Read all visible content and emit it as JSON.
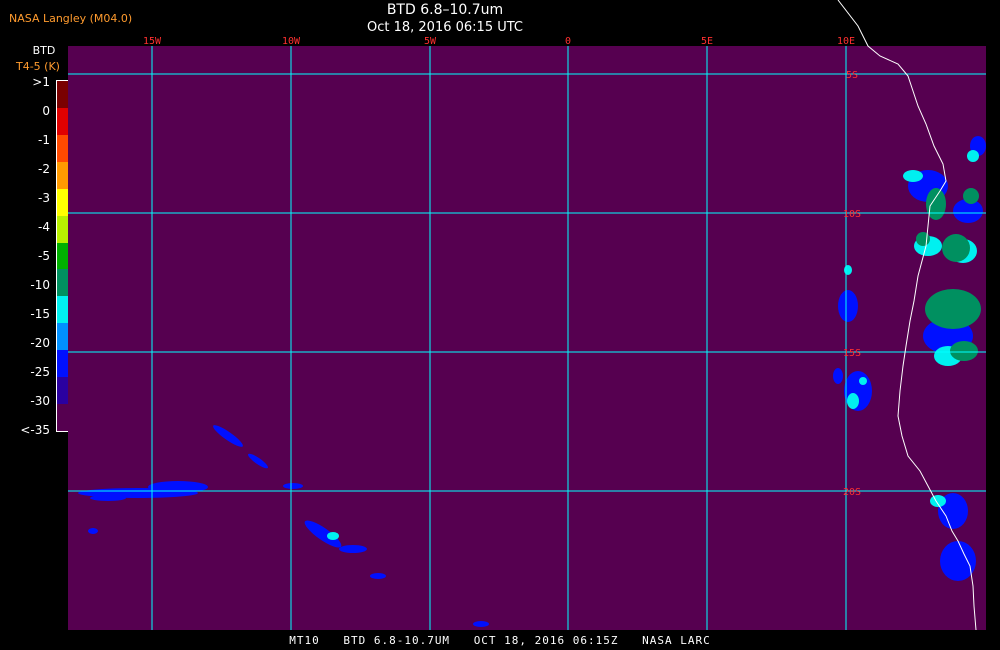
{
  "header": {
    "source": "NASA Langley (M04.0)",
    "title": "BTD 6.8–10.7um",
    "subtitle": "Oct 18, 2016 06:15 UTC"
  },
  "legend": {
    "title": "BTD",
    "units": "T4-5 (K)",
    "labels": [
      ">1",
      "0",
      "-1",
      "-2",
      "-3",
      "-4",
      "-5",
      "-10",
      "-15",
      "-20",
      "-25",
      "-30",
      "<-35"
    ],
    "colors": [
      "#7a0000",
      "#e00000",
      "#ff4a00",
      "#ff9a00",
      "#ffff00",
      "#b8f000",
      "#00b000",
      "#009060",
      "#00f0f0",
      "#0090ff",
      "#0010ff",
      "#2a00a0",
      "#560050"
    ]
  },
  "map": {
    "background_color": "#560050",
    "grid_color": "#00ffff",
    "lon_labels": [
      "15W",
      "10W",
      "5W",
      "0",
      "5E",
      "10E"
    ],
    "lat_labels": [
      "5S",
      "10S",
      "15S",
      "20S"
    ],
    "label_color": "#ff3030"
  },
  "footer": {
    "sat": "MT10",
    "product": "BTD 6.8-10.7UM",
    "datetime": "OCT 18, 2016 06:15Z",
    "agency": "NASA LARC"
  }
}
